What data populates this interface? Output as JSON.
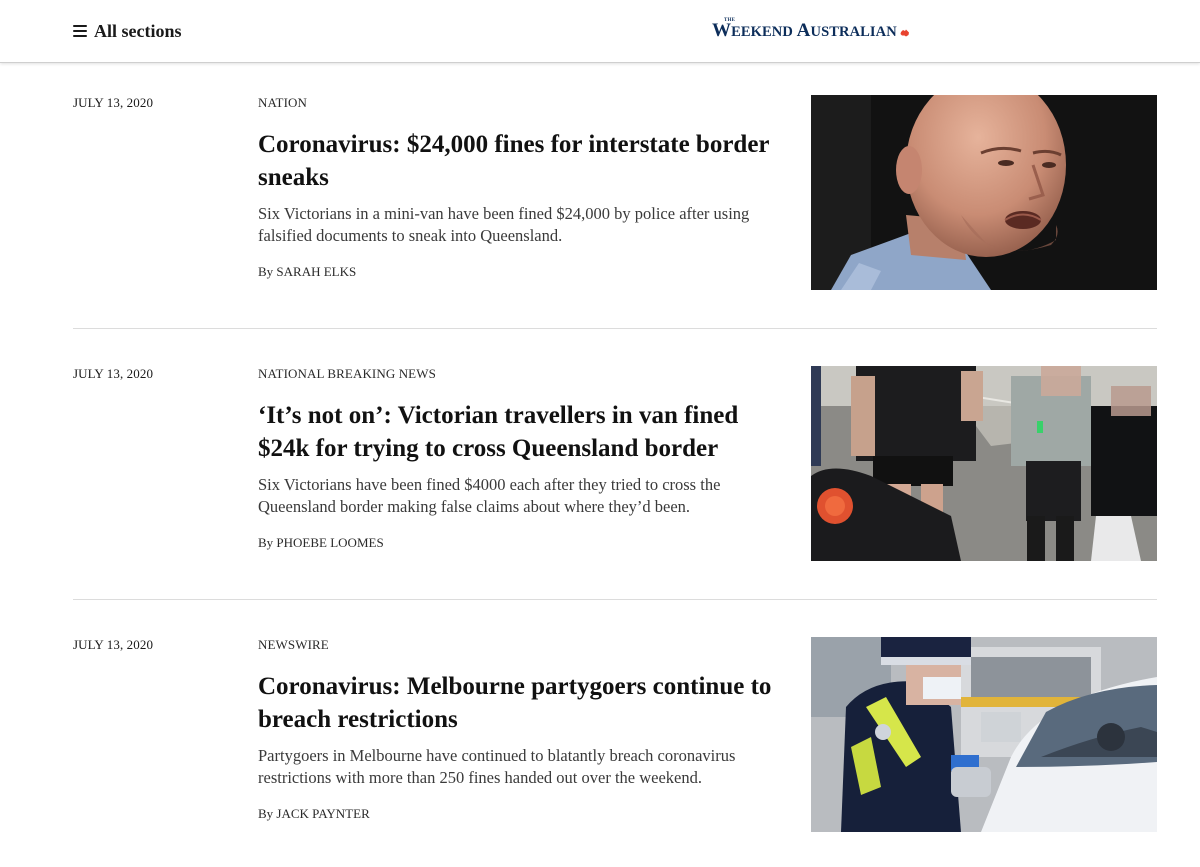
{
  "header": {
    "menu_label": "All sections",
    "masthead": {
      "the": "THE",
      "line1": "W",
      "line1_rest": "EEKEND ",
      "line2": "A",
      "line2_rest": "USTRALIAN"
    }
  },
  "articles": [
    {
      "date": "JULY 13, 2020",
      "section": "NATION",
      "headline": "Coronavirus: $24,000 fines for interstate border sneaks",
      "standfirst": "Six Victorians in a mini-van have been fined $24,000 by police after using falsified documents to sneak into Queensland.",
      "by": "By",
      "author": "SARAH ELKS",
      "image": "bald-man-speaking-photo"
    },
    {
      "date": "JULY 13, 2020",
      "section": "NATIONAL BREAKING NEWS",
      "headline": "‘It’s not on’: Victorian travellers in van fined $24k for trying to cross Queensland border",
      "standfirst": "Six Victorians have been fined $4000 each after they tried to cross the Queensland border making false claims about where they’d been.",
      "by": "By",
      "author": "PHOEBE LOOMES",
      "image": "travellers-roadside-photo"
    },
    {
      "date": "JULY 13, 2020",
      "section": "NEWSWIRE",
      "headline": "Coronavirus: Melbourne partygoers continue to breach restrictions",
      "standfirst": "Partygoers in Melbourne have continued to blatantly breach coronavirus restrictions with more than 250 fines handed out over the weekend.",
      "by": "By",
      "author": "JACK PAYNTER",
      "image": "police-checkpoint-photo"
    }
  ],
  "colors": {
    "masthead": "#0c2d5a",
    "accent": "#e8432f",
    "divider": "#dcdcdc"
  }
}
